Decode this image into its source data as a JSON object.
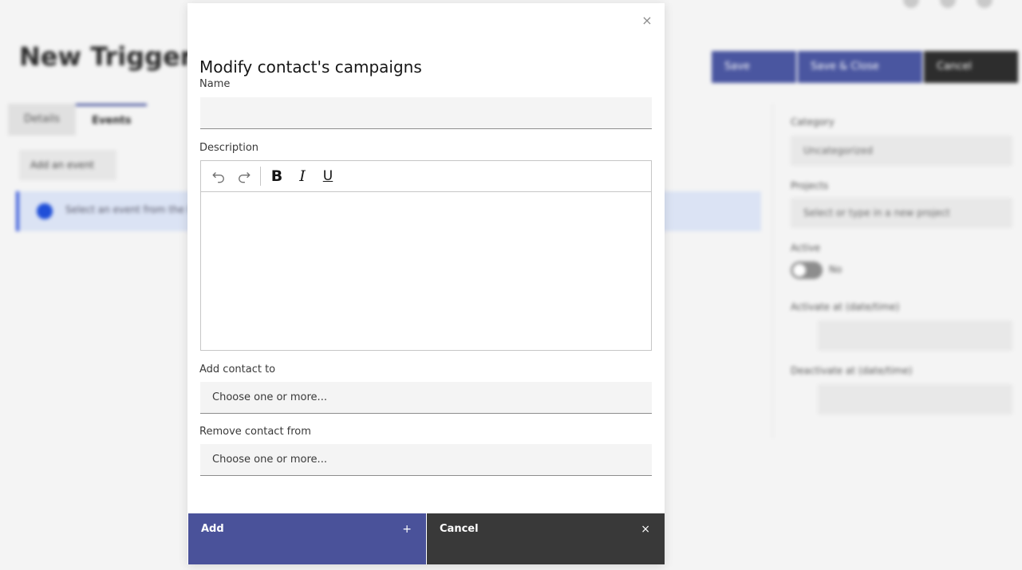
{
  "background": {
    "page_title": "New Trigger",
    "tabs": [
      "Details",
      "Events"
    ],
    "add_event_label": "Add an event",
    "notice_text": "Select an event from the list on the left to get started",
    "buttons": {
      "save": "Save",
      "save_close": "Save & Close",
      "cancel": "Cancel"
    },
    "sidebar": {
      "category_label": "Category",
      "category_value": "Uncategorized",
      "projects_label": "Projects",
      "projects_placeholder": "Select or type in a new project",
      "active_label": "Active",
      "active_value": "No",
      "activate_label": "Activate at (date/time)",
      "deactivate_label": "Deactivate at (date/time)"
    }
  },
  "modal": {
    "title": "Modify contact's campaigns",
    "name_label": "Name",
    "name_value": "",
    "description_label": "Description",
    "toolbar": {
      "undo": "undo-icon",
      "redo": "redo-icon",
      "bold": "B",
      "italic": "I",
      "underline": "U"
    },
    "add_contact_label": "Add contact to",
    "add_contact_placeholder": "Choose one or more...",
    "remove_contact_label": "Remove contact from",
    "remove_contact_placeholder": "Choose one or more...",
    "add_button": "Add",
    "add_icon": "+",
    "cancel_button": "Cancel",
    "cancel_icon": "×",
    "close_icon": "×"
  },
  "colors": {
    "primary": "#4a529a",
    "secondary": "#393939",
    "field_bg": "#f4f4f4"
  }
}
